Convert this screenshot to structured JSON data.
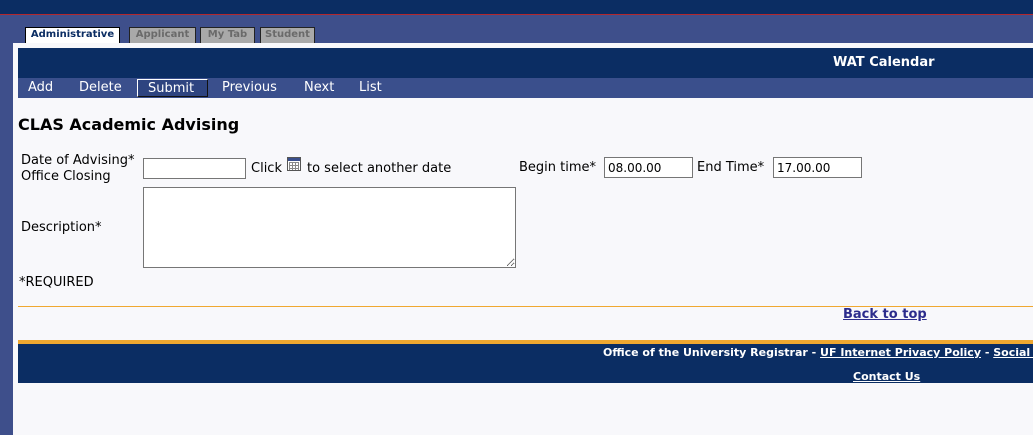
{
  "tabs": [
    {
      "label": "Administrative",
      "active": true
    },
    {
      "label": "Applicant",
      "active": false
    },
    {
      "label": "My Tab",
      "active": false
    },
    {
      "label": "Student",
      "active": false
    }
  ],
  "header": {
    "title": "WAT Calendar"
  },
  "toolbar": {
    "add": "Add",
    "delete": "Delete",
    "submit": "Submit",
    "previous": "Previous",
    "next": "Next",
    "list": "List"
  },
  "page_title": "CLAS Academic Advising",
  "form": {
    "date_label_line1": "Date of Advising*",
    "date_label_line2": "Office Closing",
    "date_value": "",
    "click_text": "Click",
    "select_date_text": "to select another date",
    "calendar_icon": "calendar-icon",
    "begin_time_label": "Begin time*",
    "begin_time_value": "08.00.00",
    "end_time_label": "End Time*",
    "end_time_value": "17.00.00",
    "description_label": "Description*",
    "description_value": "",
    "required_note": "*REQUIRED"
  },
  "back_to_top": "Back to top",
  "footer": {
    "registrar": "Office of the University Registrar",
    "sep1": " - ",
    "privacy_link": "UF Internet Privacy Policy",
    "sep2": " - ",
    "social_link": "Social Se",
    "contact_link": "Contact Us"
  },
  "colors": {
    "navy": "#0b2d63",
    "toolbar": "#3a4f8c",
    "accent_orange": "#f0a830",
    "link": "#2c2c8c"
  }
}
